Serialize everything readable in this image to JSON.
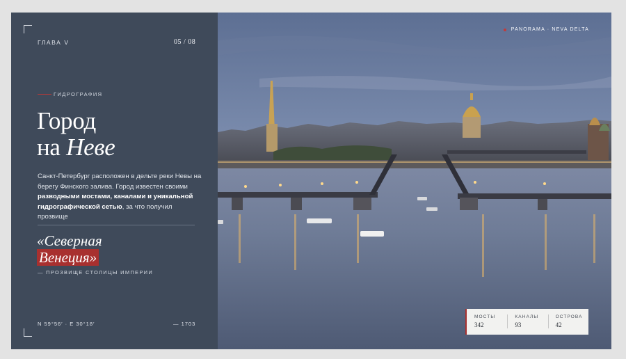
{
  "panel": {
    "chapter": "ГЛАВА V",
    "counter": "05 / 08",
    "kicker": "ГИДРОГРАФИЯ",
    "title_line1": "Город",
    "title_line2_plain": "на ",
    "title_line2_italic": "Неве",
    "desc": {
      "p1": "Санкт-Петербург расположен в дельте реки Невы на берегу Финского залива. Город известен своими ",
      "b1": "разводными мостами, каналами и уникальной гидрографической сетью",
      "p2": ", за что получил прозвище"
    },
    "nickname_line1": "«Северная",
    "nickname_line2": "Венеция»",
    "nickname_caption": "— ПРОЗВИЩЕ СТОЛИЦЫ ИМПЕРИИ",
    "coords": "N 59°56′ · E 30°18′",
    "year": "— 1703"
  },
  "photo": {
    "tag": "PANORAMA · NEVA DELTA",
    "stats": [
      {
        "label": "МОСТЫ",
        "value": "342"
      },
      {
        "label": "КАНАЛЫ",
        "value": "93"
      },
      {
        "label": "ОСТРОВА",
        "value": "42"
      }
    ]
  },
  "colors": {
    "panel_bg": "#3f4a5a",
    "accent_red": "#a8302f",
    "page_bg": "#e3e3e3"
  }
}
